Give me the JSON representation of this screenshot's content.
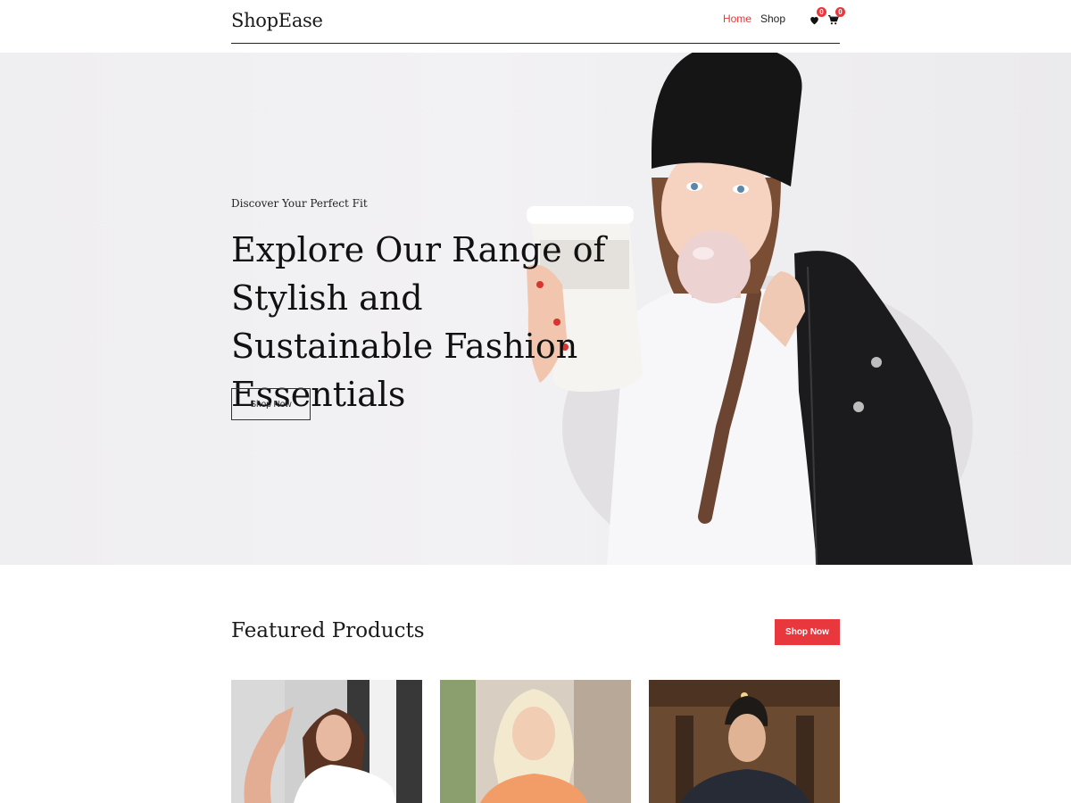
{
  "header": {
    "logo": "ShopEase",
    "nav": [
      {
        "label": "Home",
        "active": true
      },
      {
        "label": "Shop",
        "active": false
      }
    ],
    "wishlist_count": "0",
    "cart_count": "0",
    "icons": [
      "heart-icon",
      "cart-icon"
    ]
  },
  "hero": {
    "eyebrow": "Discover Your Perfect Fit",
    "title": "Explore Our Range of Stylish and Sustainable Fashion Essentials",
    "button": "Shop Now"
  },
  "featured": {
    "title": "Featured Products",
    "button": "Shop Now"
  },
  "colors": {
    "accent": "#e8383d",
    "text": "#111111",
    "hero_bg": "#efeef0"
  }
}
